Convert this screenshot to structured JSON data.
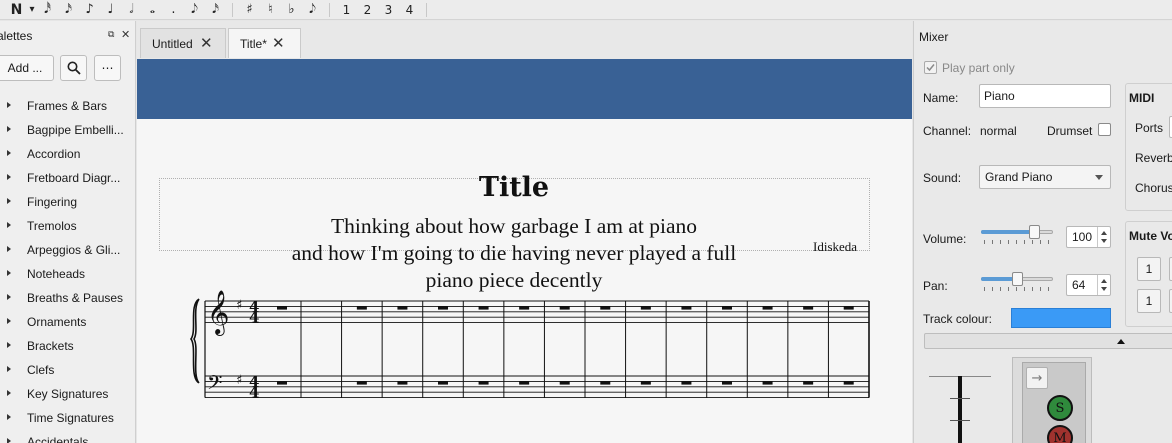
{
  "toolbar": {
    "items": [
      "N",
      "▾",
      "𝅘𝅥𝅯",
      "𝅘𝅥𝅮",
      "♪",
      "♩",
      "𝅗𝅥",
      "𝅝",
      ".",
      "𝅘𝅥𝅮",
      "𝅘𝅥𝅯",
      "♯",
      "♮",
      "♭",
      "𝅘𝅥𝅮"
    ],
    "voices": [
      "1",
      "2",
      "3",
      "4"
    ]
  },
  "palettes": {
    "title": "alettes",
    "add_label": "Add ...",
    "more_label": "⋯",
    "items": [
      "Frames & Bars",
      "Bagpipe Embelli...",
      "Accordion",
      "Fretboard Diagr...",
      "Fingering",
      "Tremolos",
      "Arpeggios & Gli...",
      "Noteheads",
      "Breaths & Pauses",
      "Ornaments",
      "Brackets",
      "Clefs",
      "Key Signatures",
      "Time Signatures",
      "Accidentals"
    ]
  },
  "tabs": [
    {
      "label": "Untitled"
    },
    {
      "label": "Title*"
    }
  ],
  "score": {
    "title": "Title",
    "subtitle_lines": [
      "Thinking about how garbage I am at piano",
      "and how I'm going to die having never played a full",
      "piano piece decently"
    ],
    "composer": "Idiskeda",
    "time_sig": [
      "4",
      "4"
    ],
    "measures": 14,
    "staff_color": "#111111"
  },
  "mixer": {
    "title": "Mixer",
    "play_part_only": "Play part only",
    "name_label": "Name:",
    "name_value": "Piano",
    "channel_label": "Channel:",
    "channel_value": "normal",
    "drumset_label": "Drumset",
    "sound_label": "Sound:",
    "sound_value": "Grand Piano",
    "volume_label": "Volume:",
    "volume_value": "100",
    "volume_level": 0.79,
    "pan_label": "Pan:",
    "pan_value": "64",
    "pan_level": 0.5,
    "track_colour_label": "Track colour:",
    "track_colour": "#3a9af6",
    "midi_label": "MIDI",
    "ports_label": "Ports",
    "reverb_label": "Reverb",
    "chorus_label": "Chorus",
    "mute_voice_label": "Mute Vo",
    "mute_buttons": [
      "1",
      "1"
    ],
    "solo_label": "S",
    "mute_label": "M",
    "solo_color": "#2f8a3c",
    "mute_color": "#a0322e"
  }
}
